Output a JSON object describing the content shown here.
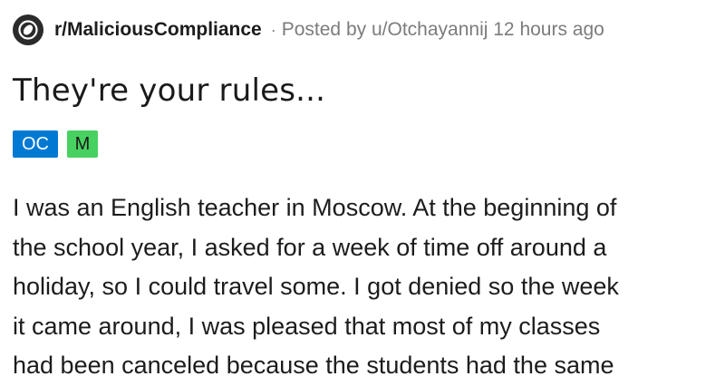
{
  "post": {
    "subreddit": "r/MaliciousCompliance",
    "separator": "·",
    "posted_by_prefix": "Posted by",
    "author": "u/Otchayannij",
    "time_ago": "12 hours ago",
    "title": "They're your rules...",
    "flairs": {
      "oc": "OC",
      "m": "M"
    },
    "body_lines": [
      "I was an English teacher in Moscow. At the beginning of",
      "the school year, I asked for a week of time off around a",
      "holiday, so I could travel some. I got denied so the week",
      "it came around, I was pleased that most of my classes",
      "had been canceled because the students had the same"
    ]
  },
  "icons": {
    "subreddit": "subreddit-logo-icon"
  },
  "colors": {
    "oc_badge": "#0079d3",
    "m_badge": "#46d160",
    "meta_text": "#7c7c7c"
  }
}
